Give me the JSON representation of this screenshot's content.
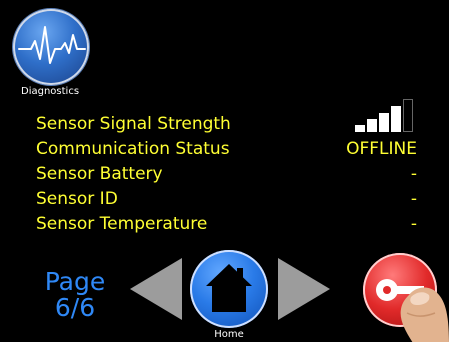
{
  "header": {
    "diagnostics_label": "Diagnostics",
    "diagnostics_icon": "heartbeat-icon"
  },
  "sensor_rows": [
    {
      "label": "Sensor Signal Strength",
      "value": ""
    },
    {
      "label": "Communication Status",
      "value": "OFFLINE"
    },
    {
      "label": "Sensor Battery",
      "value": "-"
    },
    {
      "label": "Sensor ID",
      "value": "-"
    },
    {
      "label": "Sensor Temperature",
      "value": "-"
    }
  ],
  "signal_strength": {
    "bars_total": 5,
    "bars_filled": 4,
    "icon": "signal-bars-icon"
  },
  "pagination": {
    "page_word": "Page",
    "page_value": "6/6"
  },
  "nav": {
    "home_label": "Home",
    "home_icon": "house-icon",
    "prev_icon": "left-arrow-icon",
    "next_icon": "right-arrow-icon",
    "key_icon": "key-icon"
  },
  "colors": {
    "background": "#000000",
    "text_yellow": "#ffff33",
    "page_blue": "#2f88f6",
    "button_blue": "#2a7be8",
    "button_red": "#e12a2a",
    "arrow_gray": "#9c9c9c"
  }
}
